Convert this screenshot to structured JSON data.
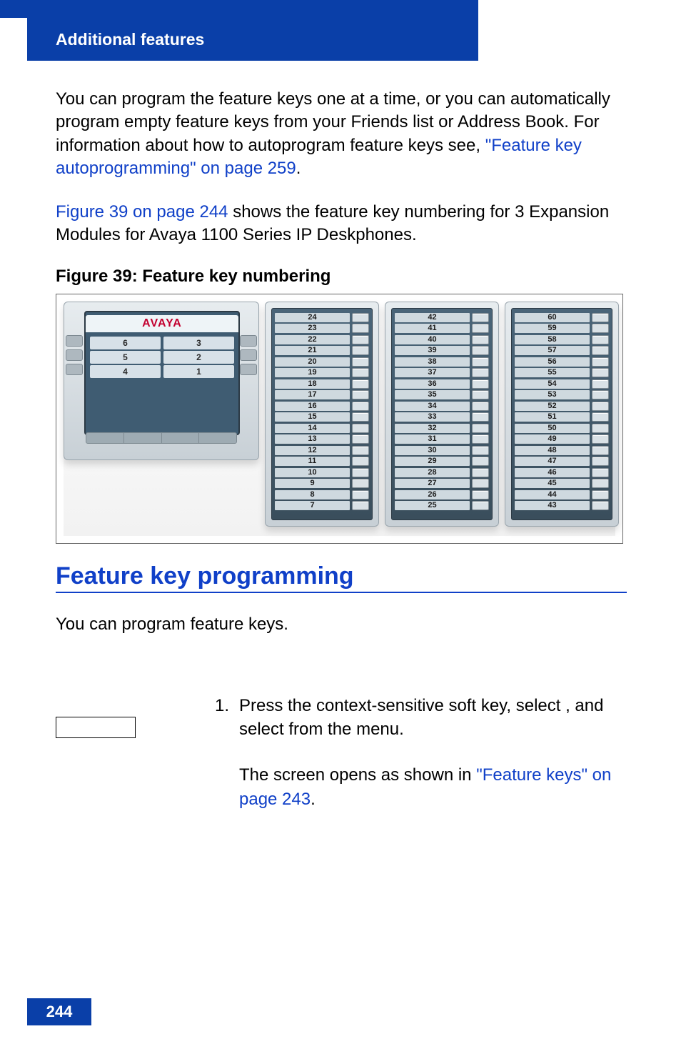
{
  "header": {
    "section_title": "Additional features"
  },
  "paras": {
    "p1_a": "You can program the feature keys one at a time, or you can automatically program empty feature keys from your Friends list or Address Book. For information about how to autoprogram feature keys see, ",
    "p1_link": "\"Feature key autoprogramming\" on page 259",
    "p1_b": ".",
    "p2_link": "Figure 39 on page 244",
    "p2_b": " shows the feature key numbering for 3 Expansion Modules for Avaya 1100 Series IP Deskphones."
  },
  "figure": {
    "caption": "Figure 39: Feature key numbering",
    "brand": "AVAYA",
    "phone_left_col": [
      "6",
      "5",
      "4"
    ],
    "phone_right_col": [
      "3",
      "2",
      "1"
    ],
    "module1": [
      "24",
      "23",
      "22",
      "21",
      "20",
      "19",
      "18",
      "17",
      "16",
      "15",
      "14",
      "13",
      "12",
      "11",
      "10",
      "9",
      "8",
      "7"
    ],
    "module2": [
      "42",
      "41",
      "40",
      "39",
      "38",
      "37",
      "36",
      "35",
      "34",
      "33",
      "32",
      "31",
      "30",
      "29",
      "28",
      "27",
      "26",
      "25"
    ],
    "module3": [
      "60",
      "59",
      "58",
      "57",
      "56",
      "55",
      "54",
      "53",
      "52",
      "51",
      "50",
      "49",
      "48",
      "47",
      "46",
      "45",
      "44",
      "43"
    ]
  },
  "section": {
    "heading": "Feature key programming",
    "intro": "You can program feature keys."
  },
  "step": {
    "num": "1.",
    "line1_a": "Press the ",
    "line1_b": " context-sensitive soft key, select ",
    "line1_c": ", and select ",
    "line1_d": " from the menu.",
    "line2_a": "The ",
    "line2_b": " screen opens as shown in ",
    "line2_link": "\"Feature keys\" on page 243",
    "line2_c": "."
  },
  "page_number": "244"
}
